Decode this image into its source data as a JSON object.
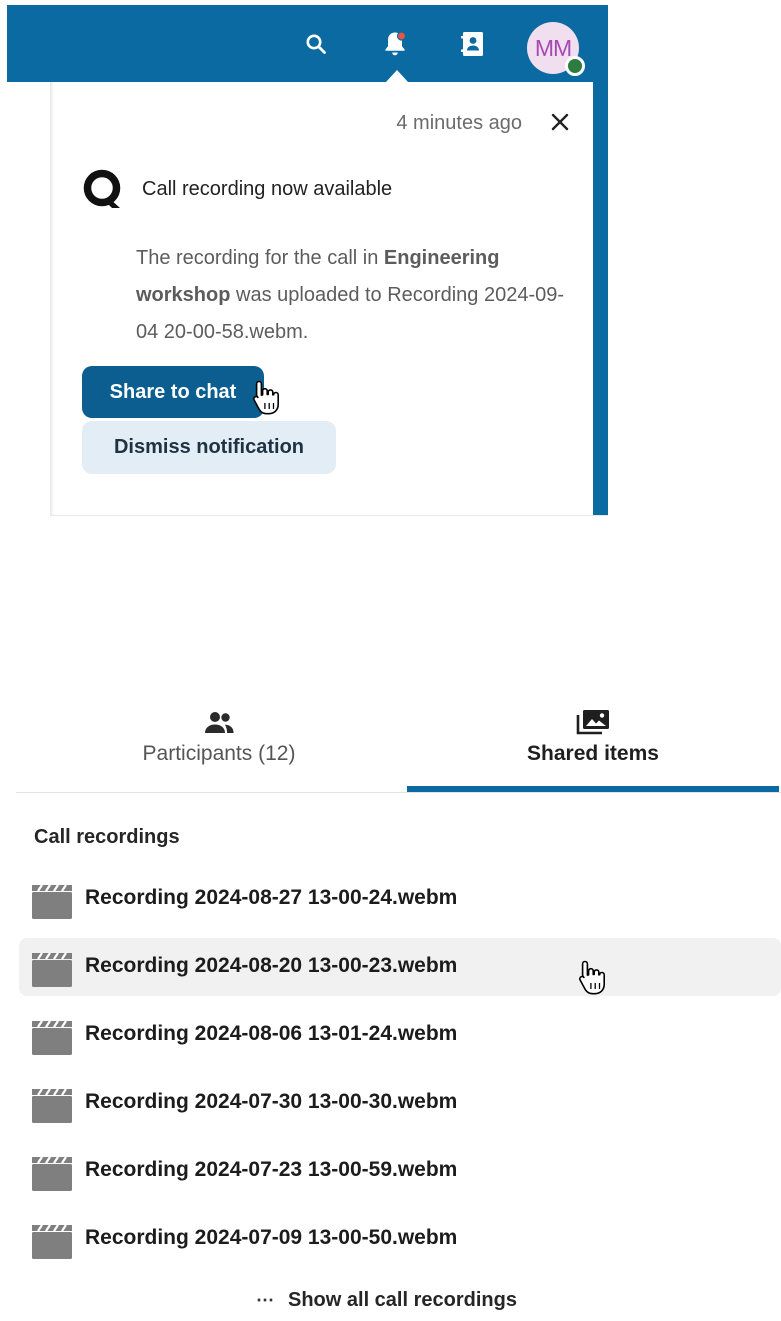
{
  "header": {
    "avatar_initials": "MM",
    "status": "online",
    "icons": [
      "search-icon",
      "bell-icon",
      "contacts-icon"
    ],
    "accent_color": "#0b6aa2"
  },
  "notification": {
    "time": "4 minutes ago",
    "title": "Call recording now available",
    "body_prefix": "The recording for the call in ",
    "body_conversation": "Engineering workshop",
    "body_suffix": " was uploaded to Recording 2024-09-04 20-00-58.webm.",
    "share_button": "Share to chat",
    "dismiss_button": "Dismiss notification"
  },
  "sidebar": {
    "tabs": [
      {
        "label": "Participants (12)",
        "icon": "people-icon",
        "active": false
      },
      {
        "label": "Shared items",
        "icon": "media-gallery-icon",
        "active": true
      }
    ]
  },
  "recordings": {
    "section_title": "Call recordings",
    "items": [
      {
        "name": "Recording 2024-08-27 13-00-24.webm"
      },
      {
        "name": "Recording 2024-08-20 13-00-23.webm",
        "hovered": true
      },
      {
        "name": "Recording 2024-08-06 13-01-24.webm"
      },
      {
        "name": "Recording 2024-07-30 13-00-30.webm"
      },
      {
        "name": "Recording 2024-07-23 13-00-59.webm"
      },
      {
        "name": "Recording 2024-07-09 13-00-50.webm"
      }
    ],
    "show_all_label": "Show all call recordings",
    "show_all_icon": "⋯"
  }
}
